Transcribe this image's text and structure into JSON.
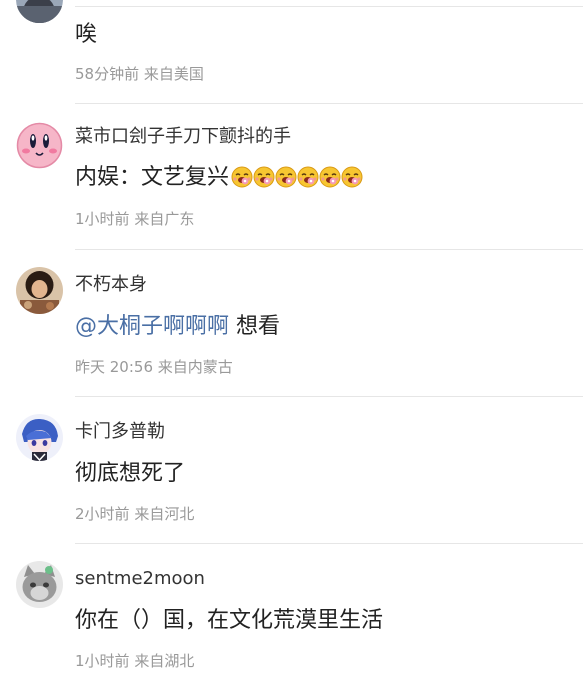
{
  "comments": [
    {
      "username": "",
      "text": "唉",
      "time": "58分钟前",
      "location": "来自美国"
    },
    {
      "username": "菜市口刽子手刀下颤抖的手",
      "text": "内娱：文艺复兴",
      "emoji": "drooling-face-emoji",
      "emoji_count": 6,
      "time": "1小时前",
      "location": "来自广东"
    },
    {
      "username": "不朽本身",
      "mention": "@大桐子啊啊啊",
      "text": " 想看",
      "time": "昨天 20:56",
      "location": "来自内蒙古"
    },
    {
      "username": "卡门多普勒",
      "text": "彻底想死了",
      "time": "2小时前",
      "location": "来自河北"
    },
    {
      "username": "sentme2moon",
      "text": "你在（）国，在文化荒漠里生活",
      "time": "1小时前",
      "location": "来自湖北"
    }
  ],
  "colors": {
    "mention": "#4a6fa5",
    "meta": "#999999",
    "divider": "#e6e6e6"
  }
}
